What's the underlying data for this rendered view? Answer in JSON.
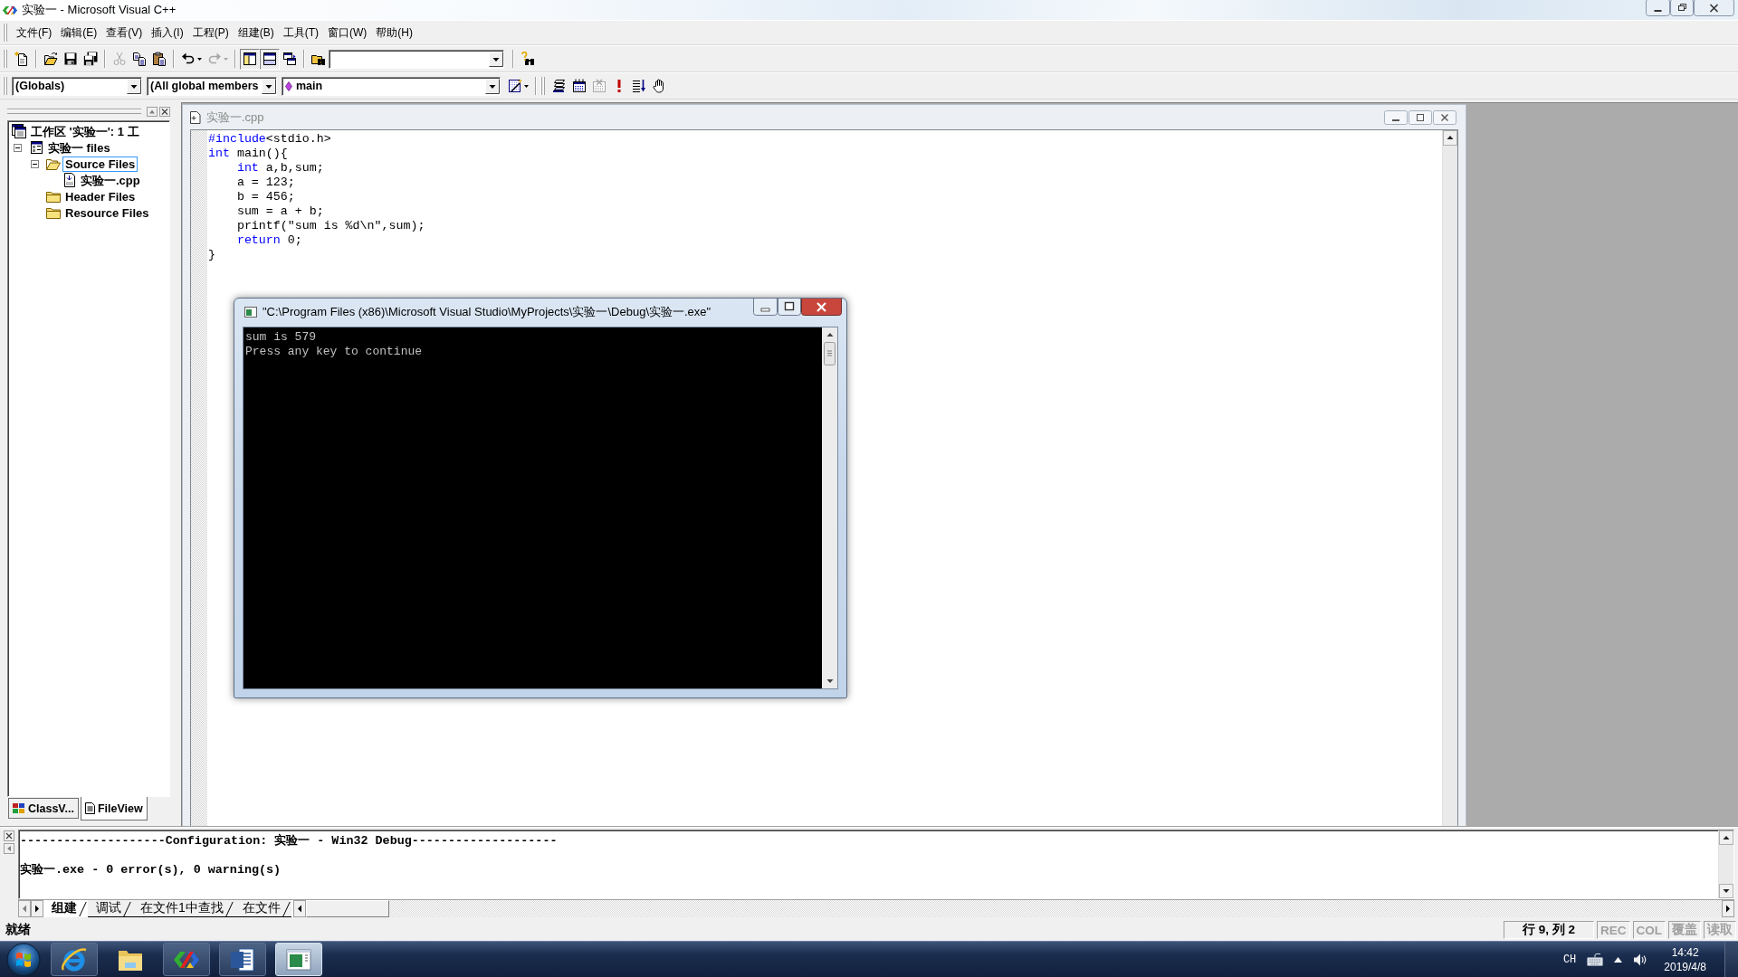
{
  "window": {
    "title": "实验一 - Microsoft Visual C++"
  },
  "menu": [
    "文件(F)",
    "编辑(E)",
    "查看(V)",
    "插入(I)",
    "工程(P)",
    "组建(B)",
    "工具(T)",
    "窗口(W)",
    "帮助(H)"
  ],
  "standard_toolbar": [
    [
      {
        "kind": "new",
        "disabled": false,
        "on": false
      }
    ],
    [
      {
        "kind": "open",
        "disabled": false,
        "on": false
      },
      {
        "kind": "save",
        "disabled": false,
        "on": false
      },
      {
        "kind": "save_all",
        "disabled": false,
        "on": false
      }
    ],
    [
      {
        "kind": "cut",
        "disabled": true,
        "on": false
      },
      {
        "kind": "copy",
        "disabled": false,
        "on": false
      },
      {
        "kind": "paste",
        "disabled": false,
        "on": false
      }
    ],
    [
      {
        "kind": "undo",
        "disabled": false,
        "on": false
      },
      {
        "kind": "redo",
        "disabled": true,
        "on": false
      }
    ],
    [
      {
        "kind": "workspace",
        "disabled": false,
        "on": true
      },
      {
        "kind": "output",
        "disabled": false,
        "on": true
      },
      {
        "kind": "windows",
        "disabled": false,
        "on": false
      }
    ],
    [
      {
        "kind": "find_in_files",
        "disabled": false,
        "on": false
      },
      {
        "kind": "find_combo"
      }
    ],
    [
      {
        "kind": "find",
        "disabled": false,
        "on": false
      }
    ]
  ],
  "wizard_toolbar": [
    [
      {
        "kind": "combo",
        "text": "(Globals)"
      },
      {
        "kind": "combo",
        "text": "(All global members"
      },
      {
        "kind": "function_combo",
        "text": "main"
      },
      {
        "kind": "wizard_action",
        "disabled": false,
        "on": false
      }
    ],
    [
      {
        "kind": "compile",
        "disabled": false,
        "on": false
      },
      {
        "kind": "build",
        "disabled": false,
        "on": false
      },
      {
        "kind": "stop_build",
        "disabled": true,
        "on": false
      },
      {
        "kind": "execute",
        "disabled": false,
        "on": false
      },
      {
        "kind": "go",
        "disabled": false,
        "on": false
      },
      {
        "kind": "breakpoint",
        "disabled": false,
        "on": false
      }
    ]
  ],
  "workspace": {
    "tree": [
      {
        "kind": "workspace",
        "label": "工作区 '实验一': 1 工",
        "selected": false,
        "children": [
          {
            "kind": "project",
            "label": "实验一 files",
            "expanded": true,
            "selected": false,
            "children": [
              {
                "kind": "folder",
                "label": "Source Files",
                "expanded": true,
                "selected": true,
                "children": [
                  {
                    "kind": "file",
                    "label": "实验一.cpp",
                    "selected": false
                  }
                ]
              },
              {
                "kind": "folder",
                "label": "Header Files",
                "selected": false
              },
              {
                "kind": "folder",
                "label": "Resource Files",
                "selected": false
              }
            ]
          }
        ]
      }
    ],
    "tabs": [
      {
        "kind": "class",
        "label": "ClassV...",
        "selected": false
      },
      {
        "kind": "file",
        "label": "FileView",
        "selected": true
      }
    ]
  },
  "editor": {
    "title": "实验一.cpp",
    "lines": [
      {
        "indented": false,
        "tokens": [
          {
            "kind": "keyword",
            "text": "#include"
          },
          {
            "kind": "plain",
            "text": "<stdio.h>"
          }
        ]
      },
      {
        "indented": false,
        "tokens": [
          {
            "kind": "keyword",
            "text": "int"
          },
          {
            "kind": "plain",
            "text": " main(){"
          }
        ]
      },
      {
        "indented": true,
        "tokens": [
          {
            "kind": "keyword",
            "text": "int"
          },
          {
            "kind": "plain",
            "text": " a,b,sum;"
          }
        ]
      },
      {
        "indented": true,
        "tokens": [
          {
            "kind": "plain",
            "text": "a = 123;"
          }
        ]
      },
      {
        "indented": true,
        "tokens": [
          {
            "kind": "plain",
            "text": "b = 456;"
          }
        ]
      },
      {
        "indented": true,
        "tokens": [
          {
            "kind": "plain",
            "text": "sum = a + b;"
          }
        ]
      },
      {
        "indented": true,
        "tokens": [
          {
            "kind": "plain",
            "text": "printf(\"sum is %d\\n\",sum);"
          }
        ]
      },
      {
        "indented": true,
        "tokens": [
          {
            "kind": "keyword",
            "text": "return"
          },
          {
            "kind": "plain",
            "text": " 0;"
          }
        ]
      },
      {
        "indented": false,
        "tokens": [
          {
            "kind": "plain",
            "text": "}"
          }
        ]
      }
    ]
  },
  "console": {
    "title": "\"C:\\Program Files (x86)\\Microsoft Visual Studio\\MyProjects\\实验一\\Debug\\实验一.exe\"",
    "lines": [
      "sum is 579",
      "Press any key to continue"
    ]
  },
  "output": {
    "lines": [
      "--------------------Configuration: 实验一 - Win32 Debug--------------------",
      "实验一.exe - 0 error(s), 0 warning(s)"
    ],
    "tabs": [
      {
        "label": "组建",
        "selected": true
      },
      {
        "label": "调试",
        "selected": false
      },
      {
        "label": "在文件1中查找",
        "selected": false
      },
      {
        "label": "在文件",
        "selected": false
      }
    ]
  },
  "status_bar": {
    "message": "就绪",
    "panes": [
      {
        "text": "行 9, 列 2",
        "enabled": true
      },
      {
        "text": "REC",
        "enabled": false
      },
      {
        "text": "COL",
        "enabled": false
      },
      {
        "text": "覆盖",
        "enabled": false
      },
      {
        "text": "读取",
        "enabled": false
      }
    ]
  },
  "taskbar": {
    "apps": [
      {
        "kind": "browser",
        "running": true,
        "selected": false
      },
      {
        "kind": "folder",
        "running": false,
        "selected": false
      },
      {
        "kind": "ide",
        "running": true,
        "selected": false
      },
      {
        "kind": "word",
        "running": true,
        "selected": false
      },
      {
        "kind": "console",
        "running": true,
        "selected": true
      }
    ],
    "tray": {
      "language": "CH",
      "time": "14:42",
      "date": "2019/4/8"
    }
  }
}
